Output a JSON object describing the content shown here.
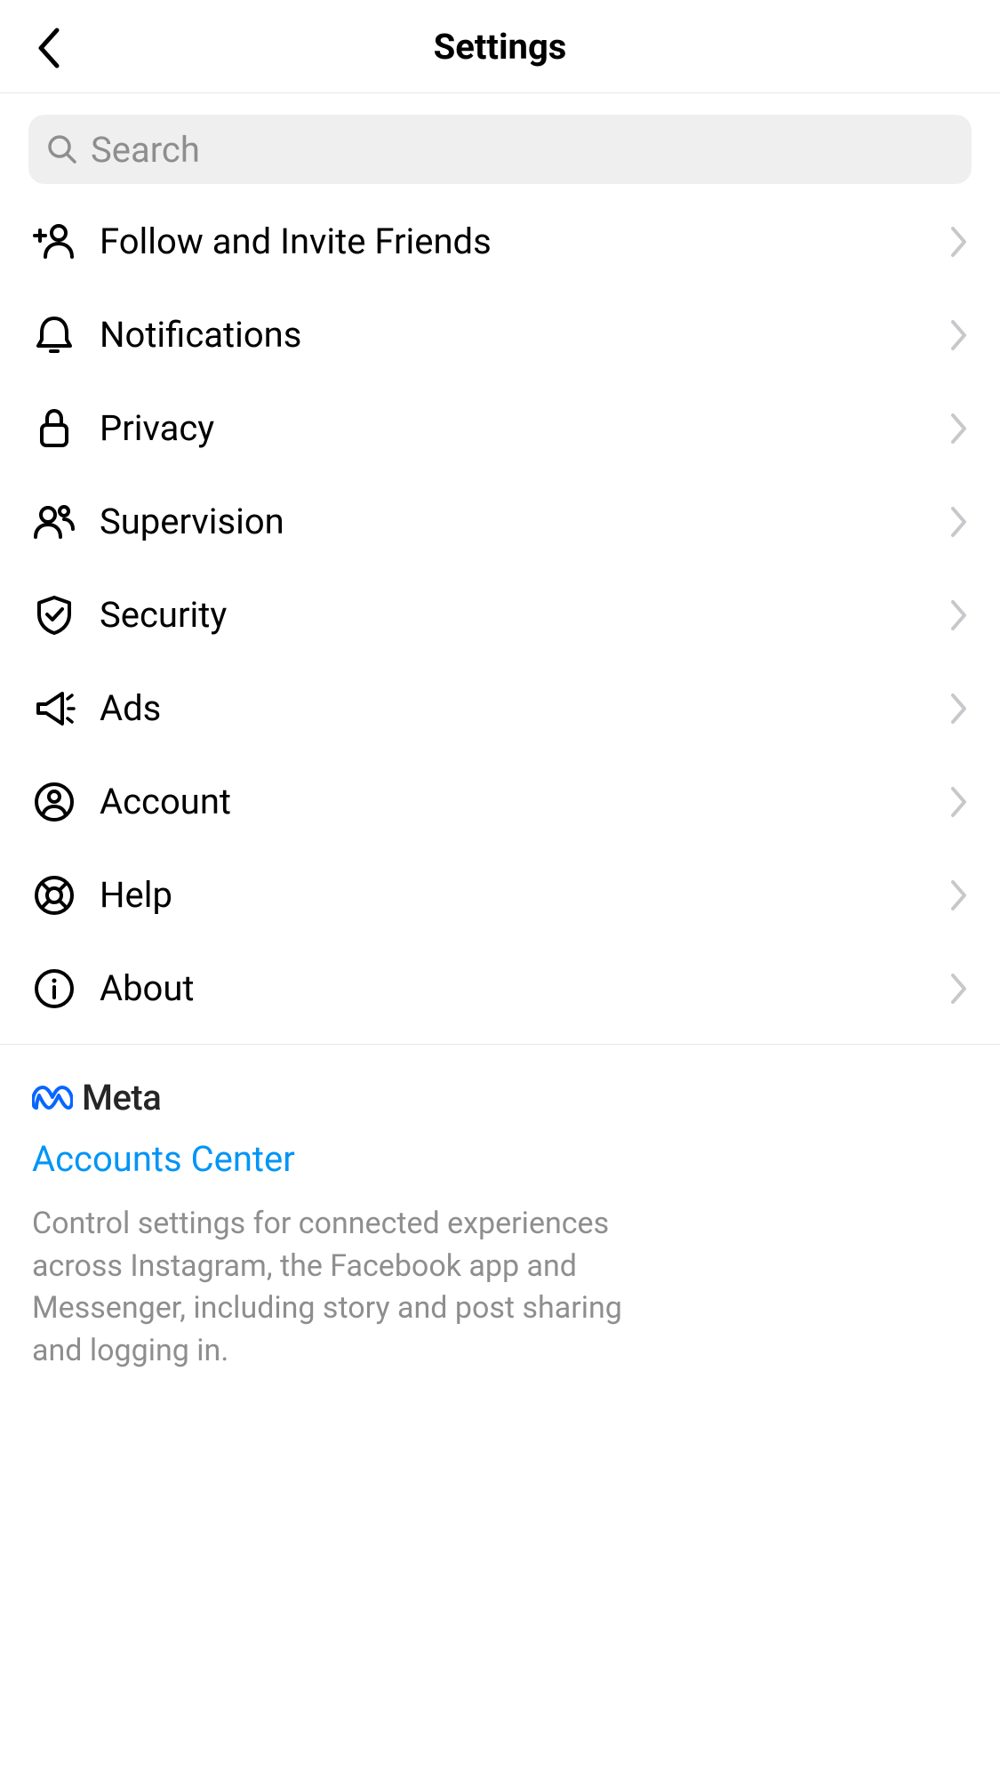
{
  "header": {
    "title": "Settings"
  },
  "search": {
    "placeholder": "Search"
  },
  "items": [
    {
      "label": "Follow and Invite Friends"
    },
    {
      "label": "Notifications"
    },
    {
      "label": "Privacy"
    },
    {
      "label": "Supervision"
    },
    {
      "label": "Security"
    },
    {
      "label": "Ads"
    },
    {
      "label": "Account"
    },
    {
      "label": "Help"
    },
    {
      "label": "About"
    }
  ],
  "footer": {
    "brand": "Meta",
    "link": "Accounts Center",
    "desc": "Control settings for connected experiences across Instagram, the Facebook app and Messenger, including story and post sharing and logging in."
  }
}
